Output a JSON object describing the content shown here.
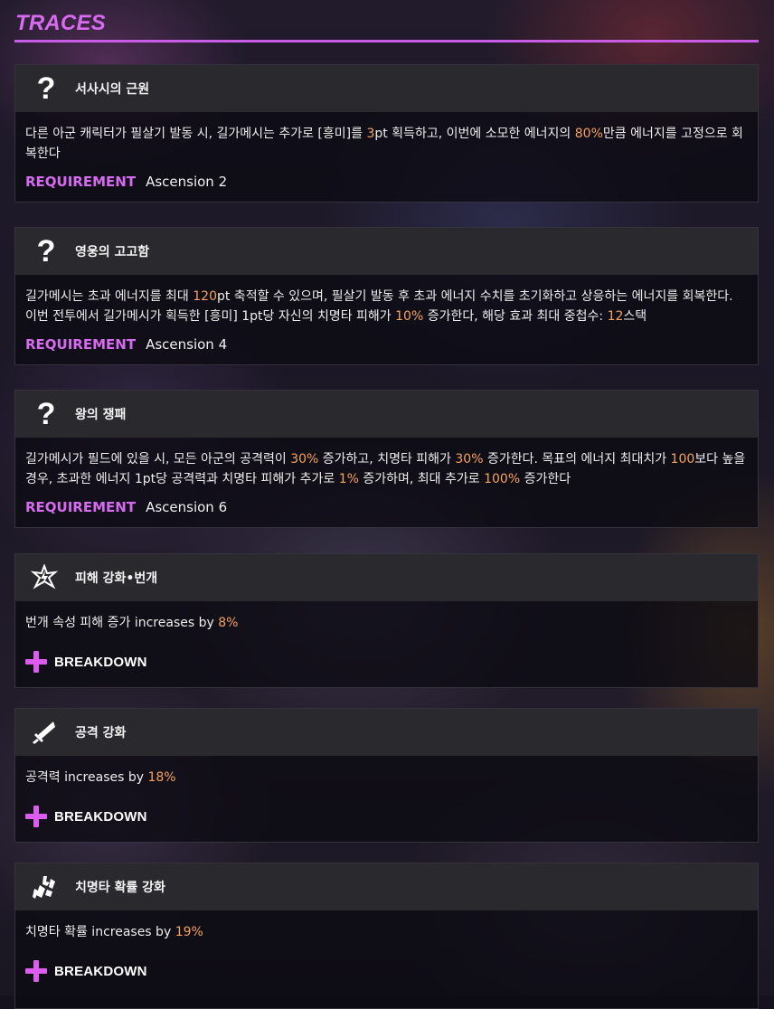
{
  "section_title": "TRACES",
  "requirement_label": "REQUIREMENT",
  "breakdown_label": "BREAKDOWN",
  "traces": [
    {
      "icon": "question-mark-icon",
      "name": "서사시의 근원",
      "desc_parts": [
        "다른 아군 캐릭터가 필살기 발동 시, 길가메시는 추가로 [흥미]를 ",
        "3",
        "pt 획득하고, 이번에 소모한 에너지의 ",
        "80%",
        "만큼 에너지를 고정으로 회복한다"
      ],
      "requirement": "Ascension 2"
    },
    {
      "icon": "question-mark-icon",
      "name": "영웅의 고고함",
      "desc_parts": [
        "길가메시는 초과 에너지를 최대 ",
        "120",
        "pt 축적할 수 있으며, 필살기 발동 후 초과 에너지 수치를 초기화하고 상응하는 에너지를 회복한다. 이번 전투에서 길가메시가 획득한 [흥미] 1pt당 자신의 치명타 피해가 ",
        "10%",
        " 증가한다, 해당 효과 최대 중첩수: ",
        "12",
        "스택"
      ],
      "requirement": "Ascension 4"
    },
    {
      "icon": "question-mark-icon",
      "name": "왕의 쟁패",
      "desc_parts": [
        "길가메시가 필드에 있을 시, 모든 아군의 공격력이 ",
        "30%",
        " 증가하고, 치명타 피해가 ",
        "30%",
        " 증가한다. 목표의 에너지 최대치가 ",
        "100",
        "보다 높을 경우, 초과한 에너지 1pt당 공격력과 치명타 피해가 추가로 ",
        "1%",
        " 증가하며, 최대 추가로 ",
        "100%",
        " 증가한다"
      ],
      "requirement": "Ascension 6"
    },
    {
      "icon": "lightning-dmg-boost-icon",
      "name": "피해 강화•번개",
      "desc_parts": [
        "번개 속성 피해 증가 increases by ",
        "8%"
      ]
    },
    {
      "icon": "sword-atk-boost-icon",
      "name": "공격 강화",
      "desc_parts": [
        "공격력 increases by ",
        "18%"
      ]
    },
    {
      "icon": "crit-rate-boost-icon",
      "name": "치명타 확률 강화",
      "desc_parts": [
        "치명타 확률 increases by ",
        "19%"
      ]
    }
  ],
  "colors": {
    "accent": "#d66bf0",
    "highlight": "#f5a35c",
    "card_header": "#2a2a2e"
  }
}
